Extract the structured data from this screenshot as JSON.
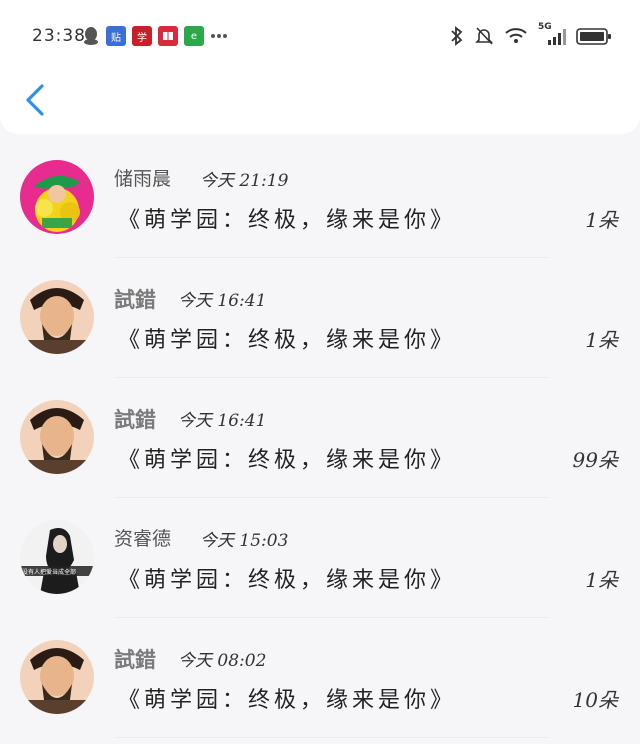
{
  "status_bar": {
    "time": "23:38",
    "left_icons": [
      "qq-icon",
      "tieba-icon",
      "app-icon",
      "book-icon",
      "wechat-icon",
      "more-dots-icon"
    ],
    "right_icons": [
      "bluetooth-icon",
      "mute-icon",
      "wifi-icon",
      "signal-icon",
      "battery-icon"
    ],
    "network": "5G"
  },
  "messages": [
    {
      "name": "储雨晨",
      "time": "今天 21:19",
      "title": "《萌学园：终极，缘来是你》",
      "count": "1朵"
    },
    {
      "name": "試錯",
      "time": "今天 16:41",
      "title": "《萌学园：终极，缘来是你》",
      "count": "1朵"
    },
    {
      "name": "試錯",
      "time": "今天 16:41",
      "title": "《萌学园：终极，缘来是你》",
      "count": "99朵"
    },
    {
      "name": "资睿德",
      "time": "今天 15:03",
      "title": "《萌学园：终极，缘来是你》",
      "count": "1朵"
    },
    {
      "name": "試錯",
      "time": "今天 08:02",
      "title": "《萌学园：终极，缘来是你》",
      "count": "10朵"
    }
  ],
  "avatar_text_4": "没有人把爱当成全部"
}
